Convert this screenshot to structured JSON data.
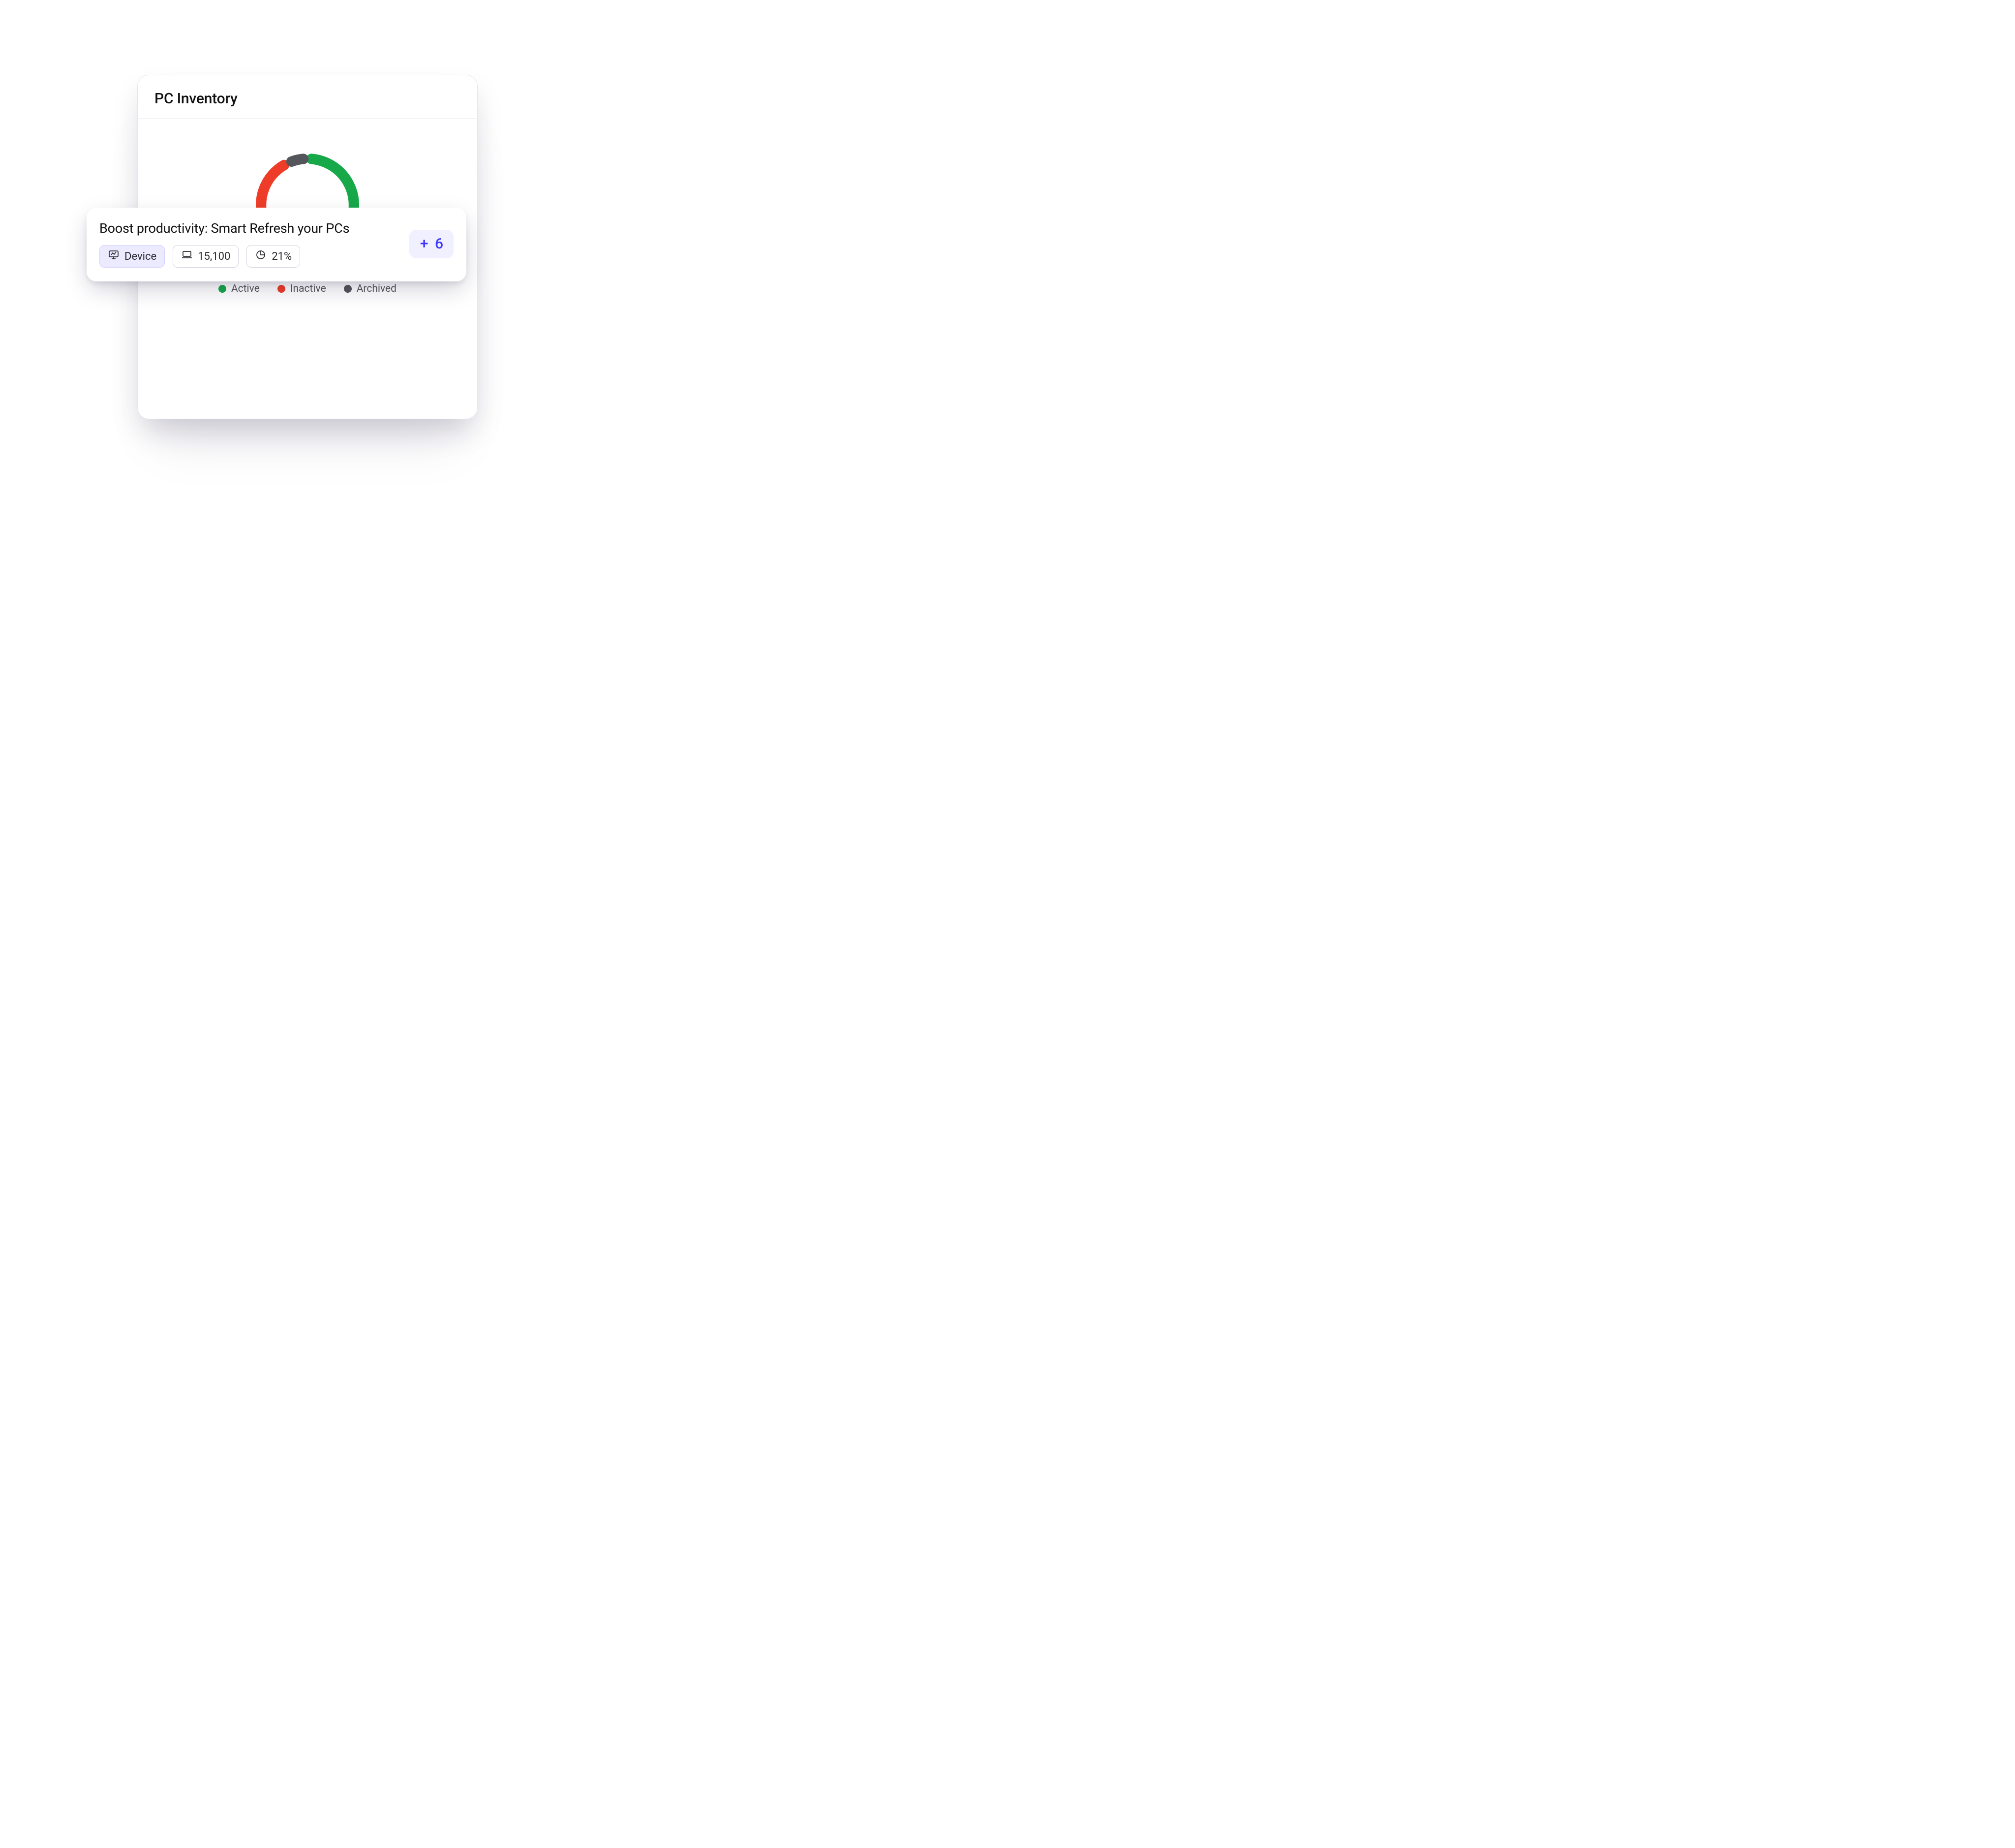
{
  "card": {
    "title": "PC Inventory"
  },
  "chart_data": {
    "type": "pie",
    "title": "PC Inventory",
    "series": [
      {
        "name": "Active",
        "value": 68,
        "color": "#17a84a"
      },
      {
        "name": "Inactive",
        "value": 25,
        "color": "#ef3c28"
      },
      {
        "name": "Archived",
        "value": 7,
        "color": "#55565c"
      }
    ],
    "legend_position": "bottom"
  },
  "legend": [
    {
      "label": "Active",
      "color": "#17a84a"
    },
    {
      "label": "Inactive",
      "color": "#ef3c28"
    },
    {
      "label": "Archived",
      "color": "#55565c"
    }
  ],
  "banner": {
    "title": "Boost productivity: Smart Refresh your PCs",
    "chips": [
      {
        "icon": "monitor-metrics-icon",
        "label": "Device",
        "active": true
      },
      {
        "icon": "laptop-icon",
        "label": "15,100",
        "active": false
      },
      {
        "icon": "pie-chart-icon",
        "label": "21%",
        "active": false
      }
    ],
    "more_badge": "+ 6"
  },
  "colors": {
    "accent": "#3b36ff",
    "chip_active_bg": "#eceaff"
  }
}
